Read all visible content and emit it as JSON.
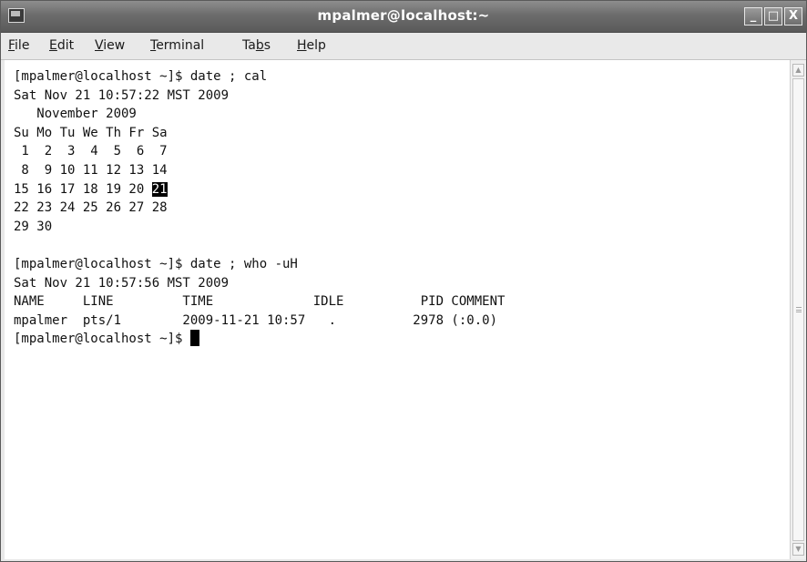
{
  "window": {
    "title": "mpalmer@localhost:~",
    "controls": {
      "minimize": "_",
      "maximize": "□",
      "close": "X"
    }
  },
  "menu": [
    {
      "prefix": "",
      "mnemonic": "F",
      "suffix": "ile"
    },
    {
      "prefix": "",
      "mnemonic": "E",
      "suffix": "dit"
    },
    {
      "prefix": "",
      "mnemonic": "V",
      "suffix": "iew"
    },
    {
      "prefix": "",
      "mnemonic": "T",
      "suffix": "erminal"
    },
    {
      "prefix": "Ta",
      "mnemonic": "b",
      "suffix": "s"
    },
    {
      "prefix": "",
      "mnemonic": "H",
      "suffix": "elp"
    }
  ],
  "terminal": {
    "lines": [
      "[mpalmer@localhost ~]$ date ; cal",
      "Sat Nov 21 10:57:22 MST 2009",
      "   November 2009",
      "Su Mo Tu We Th Fr Sa",
      " 1  2  3  4  5  6  7",
      " 8  9 10 11 12 13 14",
      "15 16 17 18 19 20 ",
      "22 23 24 25 26 27 28",
      "29 30",
      "",
      "[mpalmer@localhost ~]$ date ; who -uH",
      "Sat Nov 21 10:57:56 MST 2009",
      "NAME     LINE         TIME             IDLE          PID COMMENT",
      "mpalmer  pts/1        2009-11-21 10:57   .          2978 (:0.0)",
      "[mpalmer@localhost ~]$ "
    ],
    "highlighted_day": "21",
    "cursor_visible": true
  },
  "colors": {
    "titlebar": "#6c6c6c",
    "terminal_bg": "#ffffff",
    "terminal_fg": "#111111"
  }
}
